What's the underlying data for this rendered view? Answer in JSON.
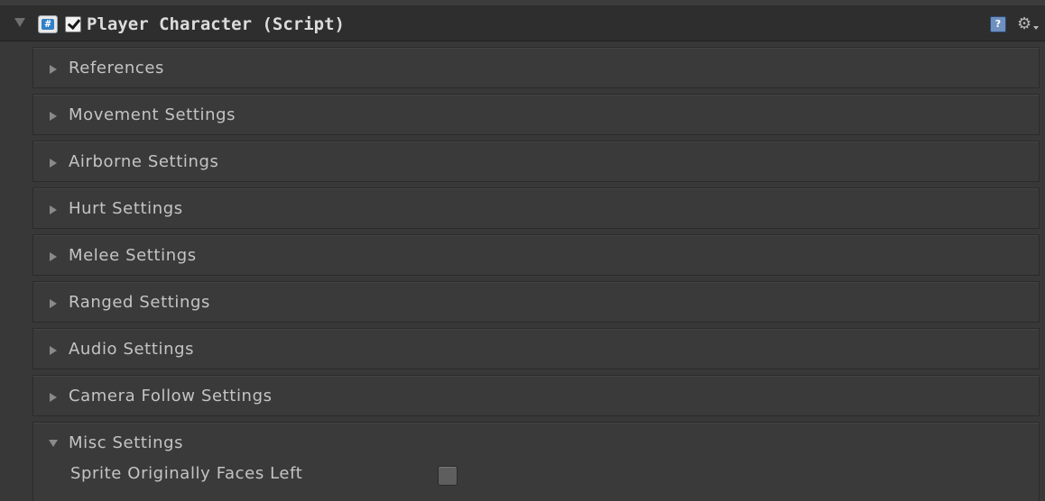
{
  "component": {
    "title": "Player Character (Script)",
    "enabled": true,
    "expanded": true,
    "icons": [
      "script-icon",
      "help-icon",
      "gear-icon"
    ]
  },
  "sections": [
    {
      "label": "References",
      "expanded": false
    },
    {
      "label": "Movement Settings",
      "expanded": false
    },
    {
      "label": "Airborne Settings",
      "expanded": false
    },
    {
      "label": "Hurt Settings",
      "expanded": false
    },
    {
      "label": "Melee Settings",
      "expanded": false
    },
    {
      "label": "Ranged Settings",
      "expanded": false
    },
    {
      "label": "Audio Settings",
      "expanded": false
    },
    {
      "label": "Camera Follow Settings",
      "expanded": false
    },
    {
      "label": "Misc Settings",
      "expanded": true
    }
  ],
  "misc": {
    "sprite_faces_left_label": "Sprite Originally Faces Left",
    "sprite_faces_left_value": false
  }
}
